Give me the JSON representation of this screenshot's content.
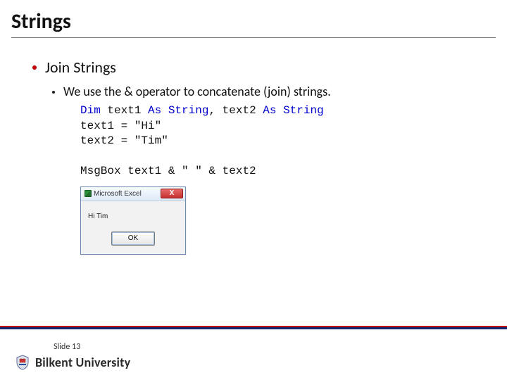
{
  "header": {
    "title": "Strings"
  },
  "bullets": {
    "l1": "Join Strings",
    "l2": "We use the & operator to concatenate (join) strings."
  },
  "code": {
    "kw_dim": "Dim",
    "c1a": " text1 ",
    "kw_as1": "As String",
    "c1b": ", text2 ",
    "kw_as2": "As String",
    "line2": "text1 = \"Hi\"",
    "line3": "text2 = \"Tim\"",
    "line5": "MsgBox text1 & \" \" & text2"
  },
  "dialog": {
    "title": "Microsoft Excel",
    "close_label": "X",
    "message": "Hi Tim",
    "ok_label": "OK"
  },
  "footer": {
    "slide_label": "Slide 13",
    "university": "Bilkent University"
  }
}
